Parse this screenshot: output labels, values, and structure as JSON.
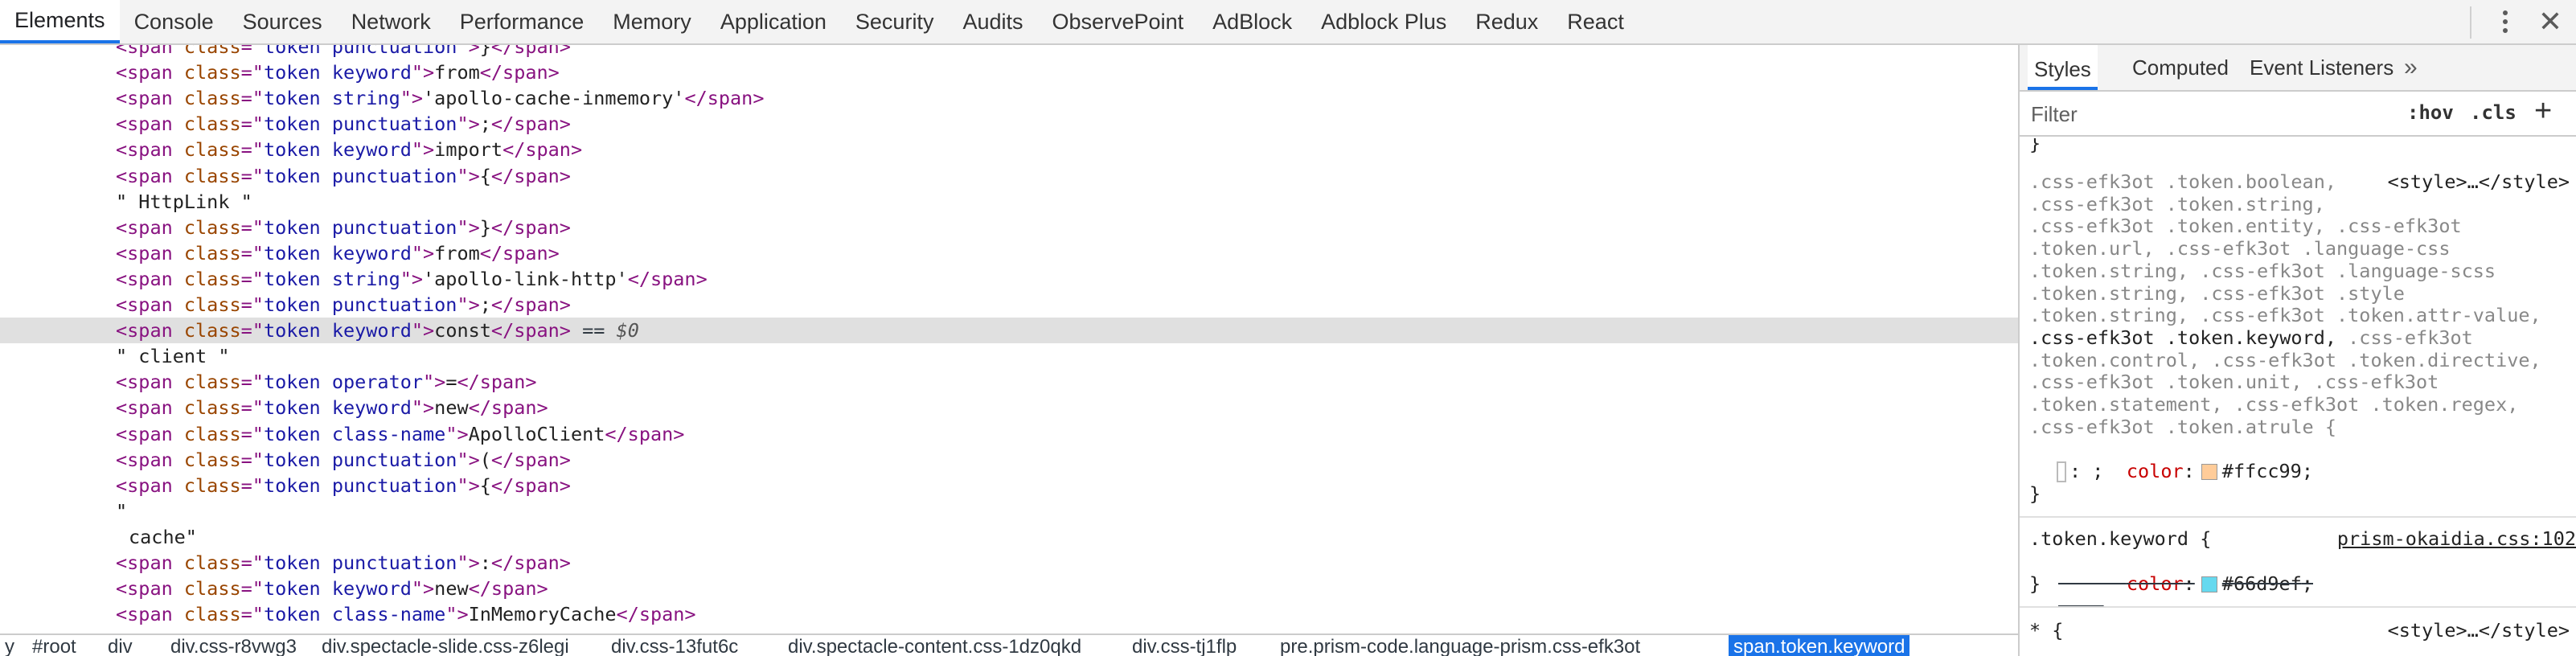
{
  "tabs": [
    {
      "label": "Elements",
      "active": true
    },
    {
      "label": "Console"
    },
    {
      "label": "Sources"
    },
    {
      "label": "Network"
    },
    {
      "label": "Performance"
    },
    {
      "label": "Memory"
    },
    {
      "label": "Application"
    },
    {
      "label": "Security"
    },
    {
      "label": "Audits"
    },
    {
      "label": "ObservePoint"
    },
    {
      "label": "AdBlock"
    },
    {
      "label": "Adblock Plus"
    },
    {
      "label": "Redux"
    },
    {
      "label": "React"
    }
  ],
  "window_controls": {
    "more_icon": "kebab-menu-icon",
    "close_icon": "close-icon",
    "close_glyph": "✕"
  },
  "dom_lines": [
    {
      "indent": 1,
      "parts": [
        [
          "tag",
          "<span "
        ],
        [
          "attr",
          "class"
        ],
        [
          "tag",
          "=\""
        ],
        [
          "val",
          "token punctuation"
        ],
        [
          "tag",
          "\">"
        ],
        [
          "plain",
          "}"
        ],
        [
          "tag",
          "</span>"
        ]
      ]
    },
    {
      "indent": 1,
      "parts": [
        [
          "tag",
          "<span "
        ],
        [
          "attr",
          "class"
        ],
        [
          "tag",
          "=\""
        ],
        [
          "val",
          "token keyword"
        ],
        [
          "tag",
          "\">"
        ],
        [
          "plain",
          "from"
        ],
        [
          "tag",
          "</span>"
        ]
      ]
    },
    {
      "indent": 1,
      "parts": [
        [
          "tag",
          "<span "
        ],
        [
          "attr",
          "class"
        ],
        [
          "tag",
          "=\""
        ],
        [
          "val",
          "token string"
        ],
        [
          "tag",
          "\">"
        ],
        [
          "plain",
          "'apollo-cache-inmemory'"
        ],
        [
          "tag",
          "</span>"
        ]
      ]
    },
    {
      "indent": 1,
      "parts": [
        [
          "tag",
          "<span "
        ],
        [
          "attr",
          "class"
        ],
        [
          "tag",
          "=\""
        ],
        [
          "val",
          "token punctuation"
        ],
        [
          "tag",
          "\">"
        ],
        [
          "plain",
          ";"
        ],
        [
          "tag",
          "</span>"
        ]
      ]
    },
    {
      "indent": 1,
      "parts": [
        [
          "tag",
          "<span "
        ],
        [
          "attr",
          "class"
        ],
        [
          "tag",
          "=\""
        ],
        [
          "val",
          "token keyword"
        ],
        [
          "tag",
          "\">"
        ],
        [
          "plain",
          "import"
        ],
        [
          "tag",
          "</span>"
        ]
      ]
    },
    {
      "indent": 1,
      "parts": [
        [
          "tag",
          "<span "
        ],
        [
          "attr",
          "class"
        ],
        [
          "tag",
          "=\""
        ],
        [
          "val",
          "token punctuation"
        ],
        [
          "tag",
          "\">"
        ],
        [
          "plain",
          "{"
        ],
        [
          "tag",
          "</span>"
        ]
      ]
    },
    {
      "indent": 1,
      "parts": [
        [
          "plain",
          "\" HttpLink \""
        ]
      ]
    },
    {
      "indent": 1,
      "parts": [
        [
          "tag",
          "<span "
        ],
        [
          "attr",
          "class"
        ],
        [
          "tag",
          "=\""
        ],
        [
          "val",
          "token punctuation"
        ],
        [
          "tag",
          "\">"
        ],
        [
          "plain",
          "}"
        ],
        [
          "tag",
          "</span>"
        ]
      ]
    },
    {
      "indent": 1,
      "parts": [
        [
          "tag",
          "<span "
        ],
        [
          "attr",
          "class"
        ],
        [
          "tag",
          "=\""
        ],
        [
          "val",
          "token keyword"
        ],
        [
          "tag",
          "\">"
        ],
        [
          "plain",
          "from"
        ],
        [
          "tag",
          "</span>"
        ]
      ]
    },
    {
      "indent": 1,
      "parts": [
        [
          "tag",
          "<span "
        ],
        [
          "attr",
          "class"
        ],
        [
          "tag",
          "=\""
        ],
        [
          "val",
          "token string"
        ],
        [
          "tag",
          "\">"
        ],
        [
          "plain",
          "'apollo-link-http'"
        ],
        [
          "tag",
          "</span>"
        ]
      ]
    },
    {
      "indent": 1,
      "parts": [
        [
          "tag",
          "<span "
        ],
        [
          "attr",
          "class"
        ],
        [
          "tag",
          "=\""
        ],
        [
          "val",
          "token punctuation"
        ],
        [
          "tag",
          "\">"
        ],
        [
          "plain",
          ";"
        ],
        [
          "tag",
          "</span>"
        ]
      ]
    },
    {
      "indent": 1,
      "selected": true,
      "parts": [
        [
          "tag",
          "<span "
        ],
        [
          "attr",
          "class"
        ],
        [
          "tag",
          "=\""
        ],
        [
          "val",
          "token keyword"
        ],
        [
          "tag",
          "\">"
        ],
        [
          "plain",
          "const"
        ],
        [
          "tag",
          "</span>"
        ],
        [
          "eq",
          " == "
        ],
        [
          "dollar",
          "$0"
        ]
      ]
    },
    {
      "indent": 1,
      "parts": [
        [
          "plain",
          "\" client \""
        ]
      ]
    },
    {
      "indent": 1,
      "parts": [
        [
          "tag",
          "<span "
        ],
        [
          "attr",
          "class"
        ],
        [
          "tag",
          "=\""
        ],
        [
          "val",
          "token operator"
        ],
        [
          "tag",
          "\">"
        ],
        [
          "plain",
          "="
        ],
        [
          "tag",
          "</span>"
        ]
      ]
    },
    {
      "indent": 1,
      "parts": [
        [
          "tag",
          "<span "
        ],
        [
          "attr",
          "class"
        ],
        [
          "tag",
          "=\""
        ],
        [
          "val",
          "token keyword"
        ],
        [
          "tag",
          "\">"
        ],
        [
          "plain",
          "new"
        ],
        [
          "tag",
          "</span>"
        ]
      ]
    },
    {
      "indent": 1,
      "parts": [
        [
          "tag",
          "<span "
        ],
        [
          "attr",
          "class"
        ],
        [
          "tag",
          "=\""
        ],
        [
          "val",
          "token class-name"
        ],
        [
          "tag",
          "\">"
        ],
        [
          "plain",
          "ApolloClient"
        ],
        [
          "tag",
          "</span>"
        ]
      ]
    },
    {
      "indent": 1,
      "parts": [
        [
          "tag",
          "<span "
        ],
        [
          "attr",
          "class"
        ],
        [
          "tag",
          "=\""
        ],
        [
          "val",
          "token punctuation"
        ],
        [
          "tag",
          "\">"
        ],
        [
          "plain",
          "("
        ],
        [
          "tag",
          "</span>"
        ]
      ]
    },
    {
      "indent": 1,
      "parts": [
        [
          "tag",
          "<span "
        ],
        [
          "attr",
          "class"
        ],
        [
          "tag",
          "=\""
        ],
        [
          "val",
          "token punctuation"
        ],
        [
          "tag",
          "\">"
        ],
        [
          "plain",
          "{"
        ],
        [
          "tag",
          "</span>"
        ]
      ]
    },
    {
      "indent": 1,
      "parts": [
        [
          "plain",
          "\""
        ]
      ]
    },
    {
      "indent": 2,
      "parts": [
        [
          "plain",
          "cache\""
        ]
      ]
    },
    {
      "indent": 1,
      "parts": [
        [
          "tag",
          "<span "
        ],
        [
          "attr",
          "class"
        ],
        [
          "tag",
          "=\""
        ],
        [
          "val",
          "token punctuation"
        ],
        [
          "tag",
          "\">"
        ],
        [
          "plain",
          ":"
        ],
        [
          "tag",
          "</span>"
        ]
      ]
    },
    {
      "indent": 1,
      "parts": [
        [
          "tag",
          "<span "
        ],
        [
          "attr",
          "class"
        ],
        [
          "tag",
          "=\""
        ],
        [
          "val",
          "token keyword"
        ],
        [
          "tag",
          "\">"
        ],
        [
          "plain",
          "new"
        ],
        [
          "tag",
          "</span>"
        ]
      ]
    },
    {
      "indent": 1,
      "parts": [
        [
          "tag",
          "<span "
        ],
        [
          "attr",
          "class"
        ],
        [
          "tag",
          "=\""
        ],
        [
          "val",
          "token class-name"
        ],
        [
          "tag",
          "\">"
        ],
        [
          "plain",
          "InMemoryCache"
        ],
        [
          "tag",
          "</span>"
        ]
      ]
    }
  ],
  "breadcrumbs": [
    {
      "label": "y"
    },
    {
      "label": "#root"
    },
    {
      "label": "div"
    },
    {
      "label": "div.css-r8vwg3"
    },
    {
      "label": "div.spectacle-slide.css-z6legi"
    },
    {
      "label": "div.css-13fut6c"
    },
    {
      "label": "div.spectacle-content.css-1dz0qkd"
    },
    {
      "label": "div.css-tj1flp"
    },
    {
      "label": "pre.prism-code.language-prism.css-efk3ot"
    },
    {
      "label": "span.token.keyword",
      "active": true
    }
  ],
  "styles_panel": {
    "tabs": [
      {
        "label": "Styles",
        "active": true
      },
      {
        "label": "Computed"
      },
      {
        "label": "Event Listeners"
      }
    ],
    "more_tabs_icon": "chevron-double-right-icon",
    "more_tabs_glyph": "»",
    "filter": {
      "placeholder": "Filter",
      "value": ""
    },
    "hov_label": ":hov",
    "cls_label": ".cls",
    "new_rule_glyph": "+",
    "top_brace": "}",
    "rule1": {
      "origin": "<style>…</style>",
      "selector_lines": [
        {
          "text": ".css-efk3ot .token.boolean,",
          "match": false
        },
        {
          "text": ".css-efk3ot .token.string,",
          "match": false
        },
        {
          "text": ".css-efk3ot .token.entity, .css-efk3ot",
          "match": false
        },
        {
          "text": ".token.url, .css-efk3ot .language-css",
          "match": false
        },
        {
          "text": ".token.string, .css-efk3ot .language-scss",
          "match": false
        },
        {
          "text": ".token.string, .css-efk3ot .style",
          "match": false
        },
        {
          "text": ".token.string, .css-efk3ot .token.attr-value,",
          "match": false
        },
        {
          "match_text": ".css-efk3ot .token.keyword,",
          "rest_text": " .css-efk3ot",
          "match": true
        },
        {
          "text": ".token.control, .css-efk3ot .token.directive,",
          "match": false
        },
        {
          "text": ".css-efk3ot .token.unit, .css-efk3ot",
          "match": false
        },
        {
          "text": ".token.statement, .css-efk3ot .token.regex,",
          "match": false
        },
        {
          "text": ".css-efk3ot .token.atrule {",
          "match": false
        }
      ],
      "property": {
        "name": "color",
        "value": "#ffcc99",
        "swatch": "#ffcc99"
      },
      "editing_text": ": ;",
      "close": "}"
    },
    "rule2": {
      "selector": ".token.keyword {",
      "origin": "prism-okaidia.css:102",
      "property": {
        "name": "color",
        "value": "#66d9ef",
        "swatch": "#66d9ef",
        "overridden": true
      },
      "close": "}"
    },
    "rule3": {
      "selector": "* {",
      "origin": "<style>…</style>"
    }
  },
  "colors": {
    "accent": "#1a73e8",
    "selected_row": "#e0e0e0",
    "tag": "#881280",
    "attr_name": "#994500",
    "attr_value": "#1a1aa6",
    "css_property": "#c80000"
  }
}
